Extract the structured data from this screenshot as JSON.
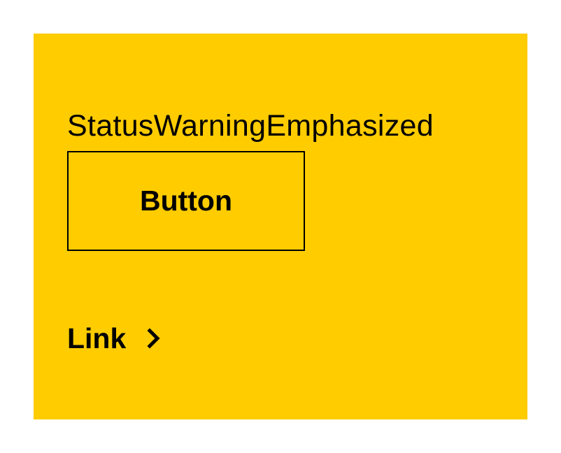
{
  "panel": {
    "title": "StatusWarningEmphasized",
    "background_color": "#ffcc00",
    "foreground_color": "#000000"
  },
  "button": {
    "label": "Button"
  },
  "link": {
    "label": "Link",
    "icon": "chevron-right-icon"
  }
}
